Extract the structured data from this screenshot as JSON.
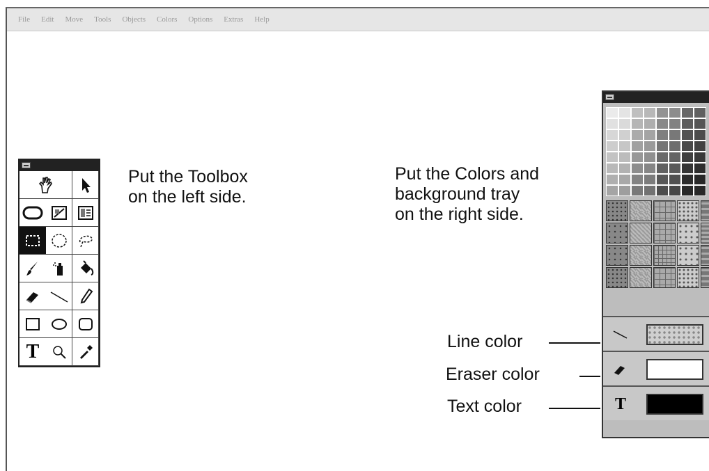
{
  "menu": {
    "items": [
      "File",
      "Edit",
      "Move",
      "Tools",
      "Objects",
      "Colors",
      "Options",
      "Extras",
      "Help"
    ]
  },
  "toolbox_caption": {
    "line1": "Put the Toolbox",
    "line2": "on the left side."
  },
  "colors_caption": {
    "line1": "Put the Colors and",
    "line2": "background tray",
    "line3": "on the right side."
  },
  "tools": [
    "hand-icon",
    "pointer-arrow-icon",
    "rounded-rect-icon",
    "image-edit-icon",
    "text-frame-icon",
    "rect-select-icon",
    "ellipse-select-icon",
    "lasso-icon",
    "brush-icon",
    "spray-can-icon",
    "fill-bucket-icon",
    "eraser-icon",
    "line-icon",
    "pencil-icon",
    "rectangle-icon",
    "ellipse-icon",
    "round-rectangle-icon",
    "text-tool-icon",
    "magnifier-icon",
    "eyedropper-icon"
  ],
  "color_rows": {
    "line": {
      "label": "Line color",
      "swatch": "#cfcfcf"
    },
    "eraser": {
      "label": "Eraser color",
      "swatch": "#ffffff"
    },
    "text": {
      "label": "Text color",
      "swatch": "#000000"
    }
  },
  "text_tool_glyph": "T",
  "colors": {
    "accent": "#222222",
    "tray_bg": "#bdbdbd"
  }
}
